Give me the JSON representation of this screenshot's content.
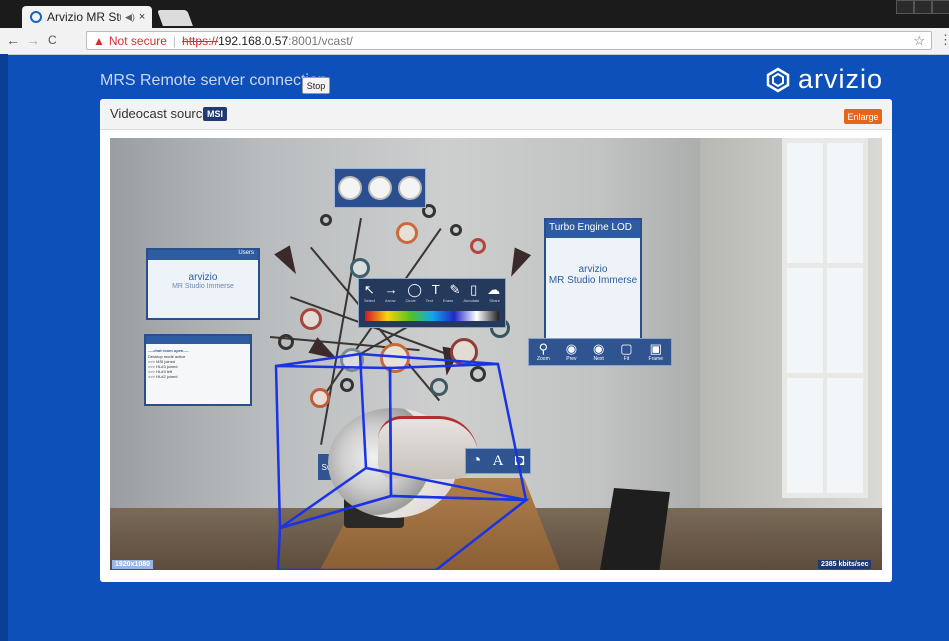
{
  "browser": {
    "tab_title": "Arvizio MR Studi",
    "tab_audio": "◀)",
    "tab_close": "×",
    "nav_back": "←",
    "nav_forward": "→",
    "nav_reload": "C",
    "security_warning": "▲",
    "security_label": "Not secure",
    "url_scheme": "https://",
    "url_host": "192.168.0.57",
    "url_path": ":8001/vcast/",
    "bookmark_star": "☆",
    "menu": "⋮"
  },
  "header": {
    "title": "MRS Remote server connection",
    "stop_label": "Stop",
    "brand": "arvizio"
  },
  "panel": {
    "source_label": "Videocast source:",
    "source_badge": "MSI",
    "enlarge_label": "Enlarge"
  },
  "video": {
    "resolution": "1920x1080",
    "bitrate": "2385 kbits/sec",
    "turbo_title": "Turbo Engine LOD",
    "card_brand": "arvizio",
    "card_sub": "MR Studio Immerse",
    "users_label": "Users",
    "console_title": "----chat room open----",
    "console_lines": [
      "Desktop mode active",
      ">>> MSI joined",
      ">>> HL#3 joined",
      ">>> HL#3 left",
      ">>> HL#2 joined"
    ],
    "tools": [
      "↖",
      "→",
      "◯",
      "T",
      "✎",
      "▯",
      "☁"
    ],
    "tool_labels": [
      "Select",
      "Arrow",
      "Circle",
      "Text",
      "Erase",
      "Annotate",
      "Share"
    ],
    "zoom_items": [
      {
        "icon": "⚲",
        "label": "Zoom"
      },
      {
        "icon": "◉",
        "label": "Prev"
      },
      {
        "icon": "◉",
        "label": "Next"
      },
      {
        "icon": "▢",
        "label": "Fit"
      },
      {
        "icon": "▣",
        "label": "Frame"
      }
    ],
    "anno_items": [
      "◔",
      "A",
      "◘"
    ],
    "switch_label": "Swi"
  },
  "colors": {
    "page_bg": "#0d50ba",
    "stop_bg": "#f4f4f4",
    "enlarge_bg": "#e5651a",
    "badge_bg": "#1f3a70",
    "bbox_stroke": "#1a33e6"
  }
}
